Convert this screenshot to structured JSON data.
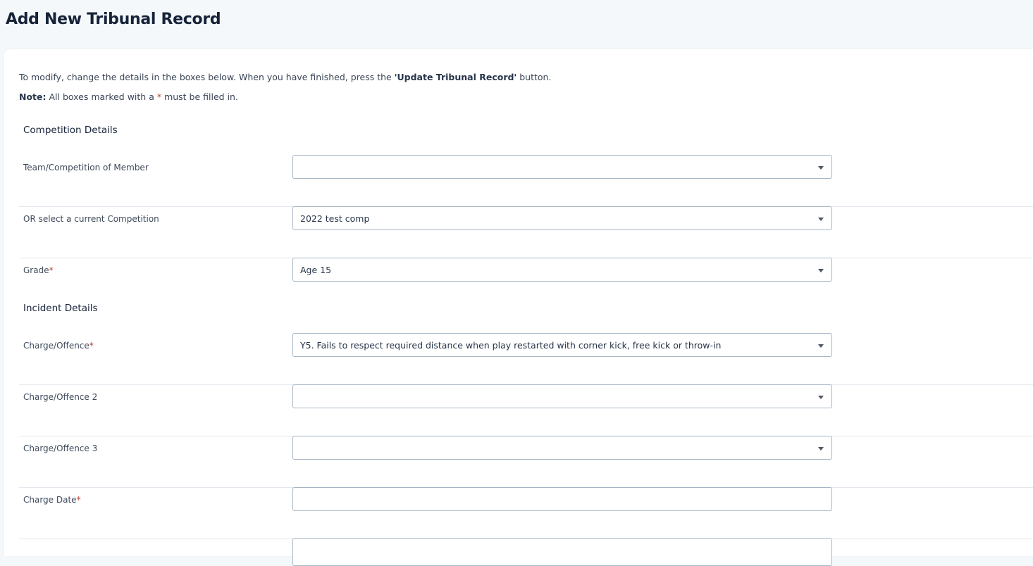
{
  "page": {
    "title": "Add New Tribunal Record"
  },
  "intro": {
    "text_before": "To modify, change the details in the boxes below. When you have finished, press the ",
    "button_ref": "'Update Tribunal Record'",
    "text_after": " button."
  },
  "note": {
    "label": "Note:",
    "text_before": " All boxes marked with a ",
    "asterisk": "*",
    "text_after": " must be filled in."
  },
  "sections": {
    "competition": "Competition Details",
    "incident": "Incident Details"
  },
  "fields": {
    "team_competition": {
      "label": "Team/Competition of Member",
      "value": ""
    },
    "current_competition": {
      "label": "OR select a current Competition",
      "value": "2022 test comp"
    },
    "grade": {
      "label": "Grade",
      "required": "*",
      "value": "Age 15"
    },
    "charge1": {
      "label": "Charge/Offence",
      "required": "*",
      "value": "Y5. Fails to respect required distance when play restarted with corner kick, free kick or throw-in"
    },
    "charge2": {
      "label": "Charge/Offence 2",
      "value": ""
    },
    "charge3": {
      "label": "Charge/Offence 3",
      "value": ""
    },
    "charge_date": {
      "label": "Charge Date",
      "required": "*",
      "value": ""
    }
  }
}
